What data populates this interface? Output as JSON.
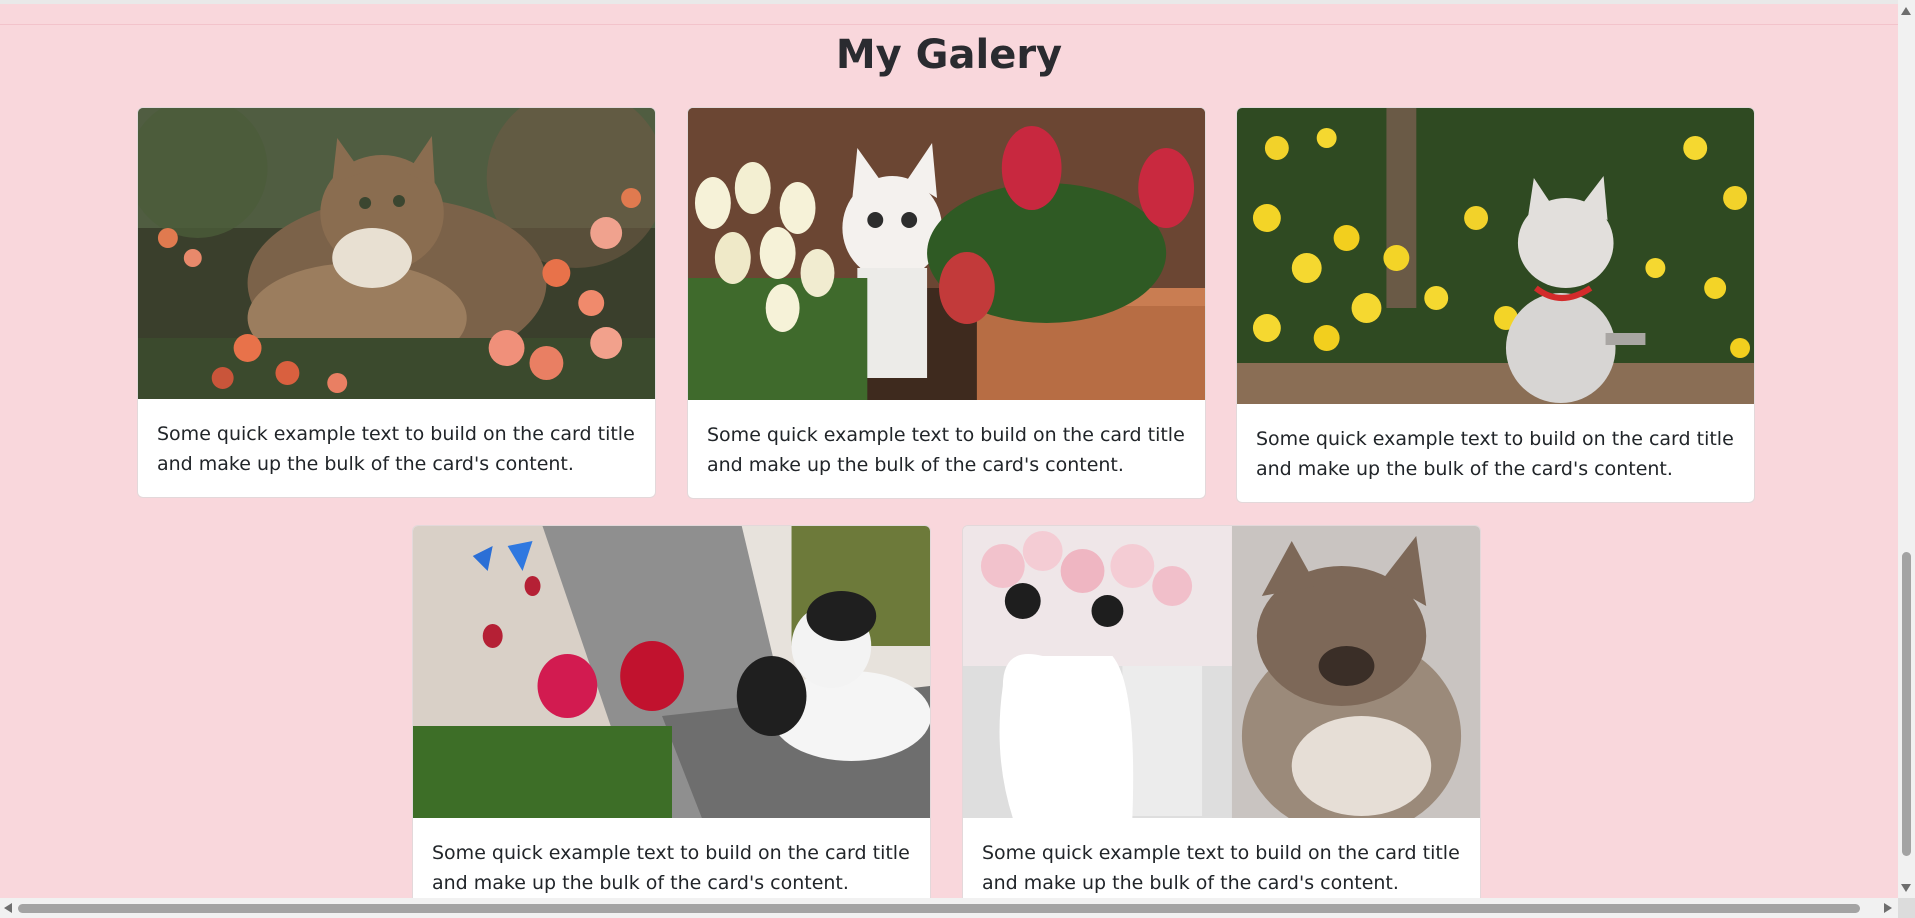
{
  "page": {
    "title": "My Galery",
    "background_color": "#f9d7dc"
  },
  "gallery": {
    "cards": [
      {
        "image_subject": "tabby cat lying among orange and pink roses",
        "text": "Some quick example text to build on the card title and make up the bulk of the card's content."
      },
      {
        "image_subject": "white kitten behind white and red tulips in a pot",
        "text": "Some quick example text to build on the card title and make up the bulk of the card's content."
      },
      {
        "image_subject": "grey kitten with red necklace in front of yellow flowers",
        "text": "Some quick example text to build on the card title and make up the bulk of the card's content."
      },
      {
        "image_subject": "black and white cat on stone wall near red flowers and blue butterfly",
        "text": "Some quick example text to build on the card title and make up the bulk of the card's content."
      },
      {
        "image_subject": "tabby cat beside white vase of pink carnations",
        "text": "Some quick example text to build on the card title and make up the bulk of the card's content."
      }
    ]
  },
  "scrollbars": {
    "vertical": {
      "up_icon": "arrow-up-icon",
      "down_icon": "arrow-down-icon"
    },
    "horizontal": {
      "left_icon": "arrow-left-icon",
      "right_icon": "arrow-right-icon"
    }
  }
}
